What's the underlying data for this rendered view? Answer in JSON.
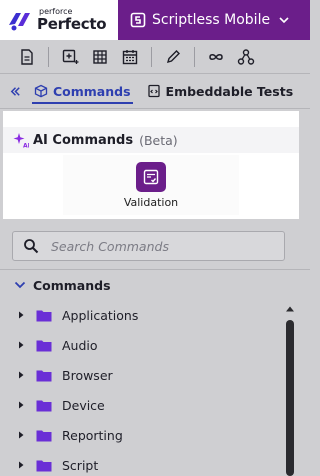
{
  "header": {
    "brand_small": "perforce",
    "brand_name": "Perfecto",
    "mode_label": "Scriptless Mobile"
  },
  "toolbar": {
    "items": [
      "file-icon",
      "add-step-icon",
      "grid-icon",
      "calendar-icon",
      "pencil-icon",
      "infinity-icon",
      "network-icon"
    ]
  },
  "tabs": [
    {
      "label": "Commands",
      "active": true,
      "icon": "cube-icon"
    },
    {
      "label": "Embeddable Tests",
      "active": false,
      "icon": "embed-icon"
    }
  ],
  "ai_commands": {
    "title": "AI Commands",
    "badge": "(Beta)",
    "tiles": [
      {
        "label": "Validation",
        "icon": "checklist-icon"
      }
    ]
  },
  "search": {
    "placeholder": "Search Commands",
    "value": ""
  },
  "commands": {
    "heading": "Commands",
    "items": [
      {
        "label": "Applications"
      },
      {
        "label": "Audio"
      },
      {
        "label": "Browser"
      },
      {
        "label": "Device"
      },
      {
        "label": "Reporting"
      },
      {
        "label": "Script"
      }
    ]
  },
  "colors": {
    "accent_purple": "#6b1e8a",
    "tab_active": "#2e3fb0",
    "folder": "#6a2fd6"
  }
}
